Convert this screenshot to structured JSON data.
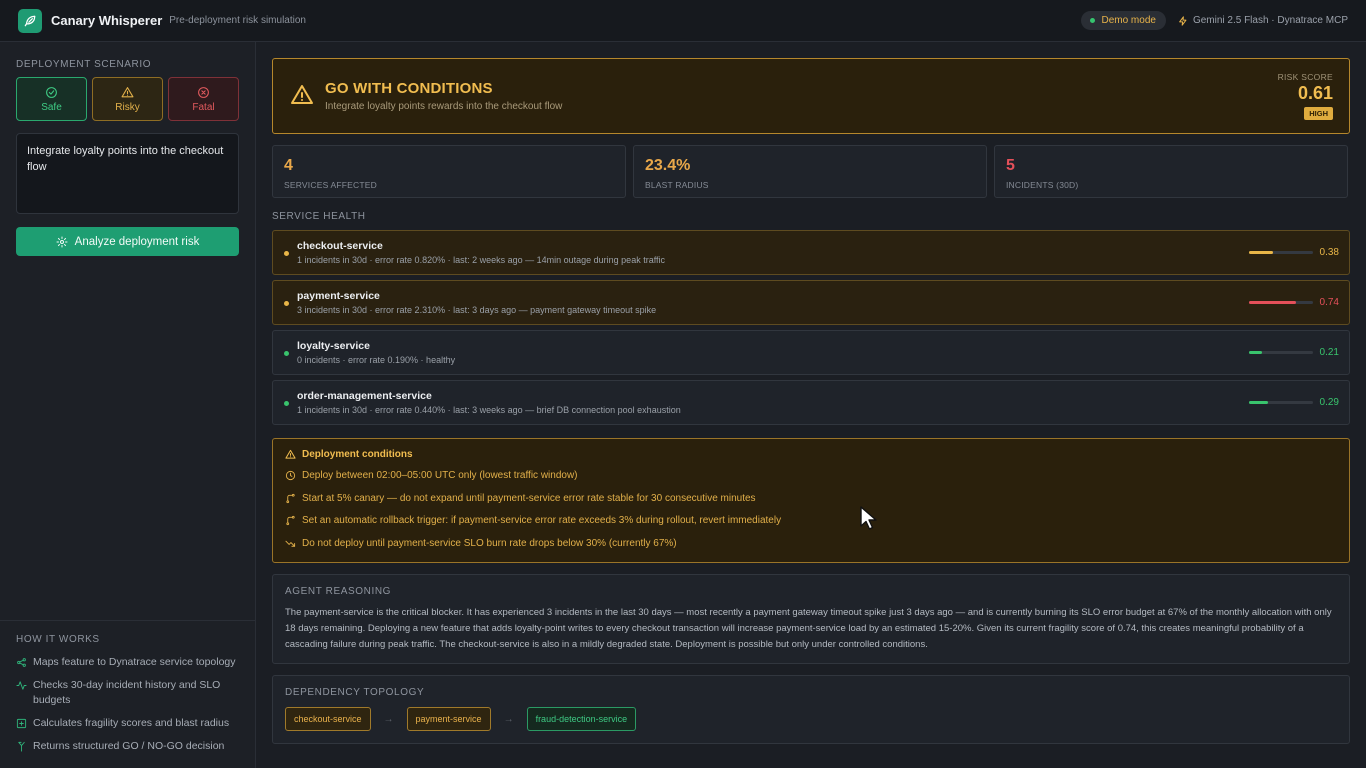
{
  "app": {
    "title": "Canary Whisperer",
    "subtitle": "Pre-deployment risk simulation",
    "demo_mode": "Demo mode",
    "model": "Gemini 2.5 Flash · Dynatrace MCP"
  },
  "sidebar": {
    "scenario_label": "DEPLOYMENT SCENARIO",
    "scenarios": [
      {
        "label": "Safe",
        "icon": "check-circle-icon",
        "color": "#3ecb84"
      },
      {
        "label": "Risky",
        "icon": "warning-triangle-icon",
        "color": "#e2b04a"
      },
      {
        "label": "Fatal",
        "icon": "x-circle-icon",
        "color": "#e0595d"
      }
    ],
    "scenario_text": "Integrate loyalty points into the checkout flow",
    "analyze_label": "Analyze deployment risk",
    "how_label": "HOW IT WORKS",
    "how_items": [
      {
        "icon": "share-nodes-icon",
        "text": "Maps feature to Dynatrace service topology"
      },
      {
        "icon": "activity-pulse-icon",
        "text": "Checks 30-day incident history and SLO budgets"
      },
      {
        "icon": "plus-square-icon",
        "text": "Calculates fragility scores and blast radius"
      },
      {
        "icon": "branch-icon",
        "text": "Returns structured GO / NO-GO decision"
      }
    ]
  },
  "decision": {
    "title": "GO WITH CONDITIONS",
    "subtitle": "Integrate loyalty points rewards into the checkout flow",
    "risk_label": "RISK SCORE",
    "risk_score": "0.61",
    "risk_level": "HIGH",
    "accent": "#f1bd50"
  },
  "stats": [
    {
      "value": "4",
      "label": "SERVICES AFFECTED",
      "color": "#e9a84a"
    },
    {
      "value": "23.4%",
      "label": "BLAST RADIUS",
      "color": "#e9a84a"
    },
    {
      "value": "5",
      "label": "INCIDENTS (30D)",
      "color": "#e4505a"
    }
  ],
  "service_health": {
    "label": "SERVICE HEALTH",
    "services": [
      {
        "name": "checkout-service",
        "meta": "1 incidents in 30d · error rate 0.820% · last: 2 weeks ago — 14min outage during peak traffic",
        "score": "0.38",
        "fragility": 0.38,
        "status": "warn",
        "color": "#e9b648"
      },
      {
        "name": "payment-service",
        "meta": "3 incidents in 30d · error rate 2.310% · last: 3 days ago — payment gateway timeout spike",
        "score": "0.74",
        "fragility": 0.74,
        "status": "warn",
        "color": "#e4505a"
      },
      {
        "name": "loyalty-service",
        "meta": "0 incidents · error rate 0.190% · healthy",
        "score": "0.21",
        "fragility": 0.21,
        "status": "ok",
        "color": "#39c46d"
      },
      {
        "name": "order-management-service",
        "meta": "1 incidents in 30d · error rate 0.440% · last: 3 weeks ago — brief DB connection pool exhaustion",
        "score": "0.29",
        "fragility": 0.29,
        "status": "ok",
        "color": "#39c46d"
      }
    ]
  },
  "conditions": {
    "title": "Deployment conditions",
    "items": [
      {
        "icon": "clock-icon",
        "text": "Deploy between 02:00–05:00 UTC only (lowest traffic window)"
      },
      {
        "icon": "git-branch-icon",
        "text": "Start at 5% canary — do not expand until payment-service error rate stable for 30 consecutive minutes"
      },
      {
        "icon": "git-branch-icon",
        "text": "Set an automatic rollback trigger: if payment-service error rate exceeds 3% during rollout, revert immediately"
      },
      {
        "icon": "trend-down-icon",
        "text": "Do not deploy until payment-service SLO burn rate drops below 30% (currently 67%)"
      }
    ]
  },
  "reasoning": {
    "label": "AGENT REASONING",
    "text": "The payment-service is the critical blocker. It has experienced 3 incidents in the last 30 days — most recently a payment gateway timeout spike just 3 days ago — and is currently burning its SLO error budget at 67% of the monthly allocation with only 18 days remaining. Deploying a new feature that adds loyalty-point writes to every checkout transaction will increase payment-service load by an estimated 15-20%. Given its current fragility score of 0.74, this creates meaningful probability of a cascading failure during peak traffic. The checkout-service is also in a mildly degraded state. Deployment is possible but only under controlled conditions."
  },
  "topology": {
    "label": "DEPENDENCY TOPOLOGY",
    "nodes": [
      "checkout-service",
      "payment-service",
      "fraud-detection-service"
    ],
    "arrow": "→"
  }
}
